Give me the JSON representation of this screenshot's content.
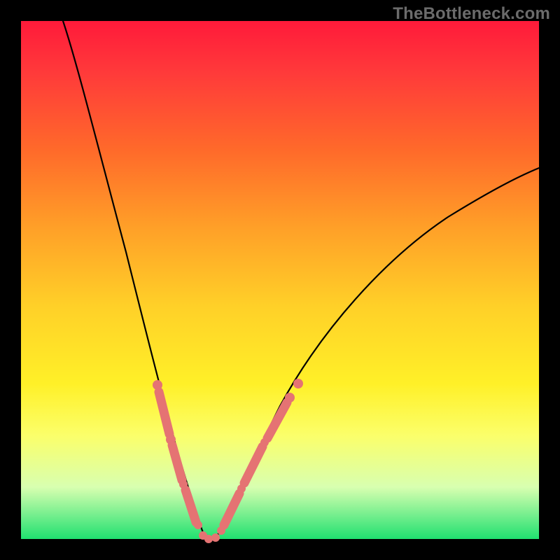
{
  "watermark": "TheBottleneck.com",
  "colors": {
    "background": "#000000",
    "gradient_top": "#ff1a3a",
    "gradient_bottom": "#20e070",
    "curve": "#000000",
    "marker": "#e57373"
  },
  "chart_data": {
    "type": "line",
    "title": "",
    "xlabel": "",
    "ylabel": "",
    "xlim": [
      0,
      100
    ],
    "ylim": [
      0,
      100
    ],
    "grid": false,
    "series": [
      {
        "name": "bottleneck-curve",
        "x": [
          8,
          10,
          12,
          15,
          18,
          21,
          24,
          26,
          28,
          30,
          31,
          32,
          33,
          34,
          35,
          36,
          38,
          40,
          43,
          46,
          50,
          55,
          60,
          65,
          70,
          75,
          80,
          85,
          90,
          95,
          100
        ],
        "y": [
          100,
          92,
          85,
          75,
          65,
          55,
          45,
          37,
          30,
          22,
          17,
          12,
          8,
          4,
          2,
          2,
          4,
          8,
          14,
          20,
          27,
          34,
          40,
          46,
          51,
          55,
          59,
          62,
          65,
          68,
          70
        ]
      }
    ],
    "annotations": {
      "highlighted_points_left": [
        {
          "x": 25.5,
          "y": 39
        },
        {
          "x": 26.4,
          "y": 35
        },
        {
          "x": 27.2,
          "y": 31
        },
        {
          "x": 28.0,
          "y": 27
        },
        {
          "x": 28.8,
          "y": 23
        },
        {
          "x": 29.7,
          "y": 19
        },
        {
          "x": 30.5,
          "y": 15
        },
        {
          "x": 31.4,
          "y": 11
        },
        {
          "x": 32.3,
          "y": 7
        },
        {
          "x": 33.5,
          "y": 3
        }
      ],
      "highlighted_points_right": [
        {
          "x": 36.5,
          "y": 3
        },
        {
          "x": 37.6,
          "y": 6
        },
        {
          "x": 38.8,
          "y": 9
        },
        {
          "x": 40.0,
          "y": 12
        },
        {
          "x": 41.3,
          "y": 15
        },
        {
          "x": 42.6,
          "y": 18
        },
        {
          "x": 44.0,
          "y": 21
        },
        {
          "x": 45.5,
          "y": 24
        },
        {
          "x": 47.0,
          "y": 27
        },
        {
          "x": 48.5,
          "y": 30
        }
      ]
    }
  }
}
